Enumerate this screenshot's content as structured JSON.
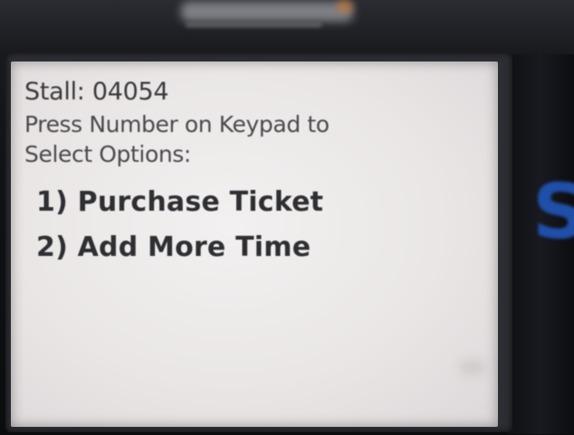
{
  "screen": {
    "stall_line": "Stall: 04054",
    "instruction_line1": "Press Number on Keypad to",
    "instruction_line2": "Select Options:",
    "options": [
      {
        "label": "1) Purchase Ticket"
      },
      {
        "label": "2) Add More Time"
      }
    ]
  },
  "colors": {
    "screen_background": "#eae6e6",
    "text": "#3a3a3d",
    "housing": "#111216",
    "side_accent": "#1f4fa8"
  }
}
